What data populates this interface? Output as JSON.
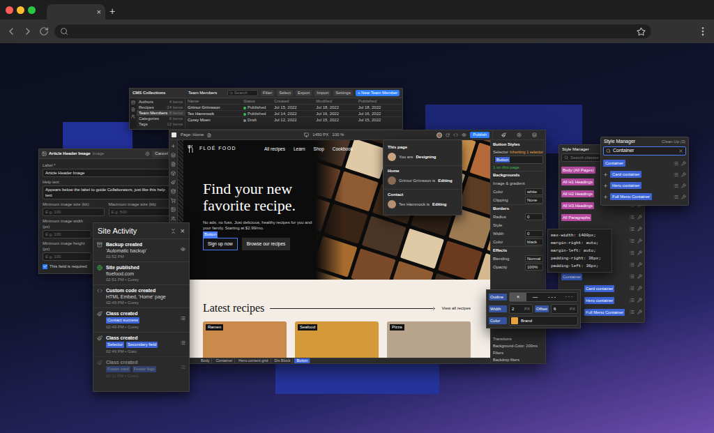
{
  "browser": {
    "tab_close": "×",
    "new_tab": "+"
  },
  "cms": {
    "title": "CMS Collections",
    "collection": "Team Members",
    "search": "Search",
    "actions": [
      "Filter",
      "Select",
      "Export",
      "Import",
      "Settings"
    ],
    "new_item": "+ New Team Member",
    "collections": [
      {
        "name": "Authors",
        "count": "4 items",
        "selected": false
      },
      {
        "name": "Recipes",
        "count": "24 items",
        "selected": false
      },
      {
        "name": "Team Members",
        "count": "8 items",
        "selected": true
      },
      {
        "name": "Categories",
        "count": "6 items",
        "selected": false
      },
      {
        "name": "Tags",
        "count": "12 items",
        "selected": false
      }
    ],
    "columns": [
      "Name",
      "Status",
      "Created",
      "Modified",
      "Published"
    ],
    "rows": [
      {
        "name": "Grímur Grímsson",
        "status": "Published",
        "color": "#3fb950",
        "created": "Jul 15, 2022",
        "modified": "Jul 18, 2022",
        "published": "Jul 18, 2022"
      },
      {
        "name": "Tex Hammock",
        "status": "Published",
        "color": "#3fb950",
        "created": "Jul 14, 2022",
        "modified": "Jul 16, 2022",
        "published": "Jul 16, 2022"
      },
      {
        "name": "Corey Moen",
        "status": "Draft",
        "color": "#8a8a8a",
        "created": "Jul 12, 2022",
        "modified": "Jul 15, 2022",
        "published": "Jul 15, 2022"
      }
    ]
  },
  "field_settings": {
    "title": "Article Header Image",
    "type": "Image",
    "cancel": "Cancel",
    "label_caption": "Label *",
    "label_value": "Article Header Image",
    "help_caption": "Help text",
    "help_value": "Appears below the label to guide Collaborators, just like this help text",
    "size_fields": [
      {
        "label": "Minimum image size (kb)",
        "placeholder": "E.g. 100"
      },
      {
        "label": "Maximum image size (kb)",
        "placeholder": "E.g. 500"
      }
    ],
    "dimension_fields": [
      {
        "label": "Minimum image width (px)",
        "placeholder": "E.g. 100"
      },
      {
        "label": "Minimum image height (px)",
        "placeholder": "E.g. 100"
      }
    ],
    "required": {
      "label": "This field is required",
      "checked": true
    }
  },
  "site_activity": {
    "title": "Site Activity",
    "close": "×",
    "items": [
      {
        "kind": "backup",
        "title": "Backup created",
        "detail": "'Automatic backup'",
        "tags": [],
        "meta": "02:52 PM",
        "faded": false
      },
      {
        "kind": "publish",
        "title": "Site published",
        "detail": "floefood.com",
        "tags": [],
        "meta": "02:51 PM • Corey",
        "faded": false
      },
      {
        "kind": "code",
        "title": "Custom code created",
        "detail": "HTML Embed, 'Home' page",
        "tags": [],
        "meta": "02:49 PM • Corey",
        "faded": false
      },
      {
        "kind": "class",
        "title": "Class created",
        "tags": [
          "Contact success"
        ],
        "meta": "02:49 PM • Corey",
        "faded": false
      },
      {
        "kind": "class",
        "title": "Class created",
        "tags": [
          "Selector",
          "Secondary field"
        ],
        "meta": "02:49 PM • Gato",
        "faded": false
      },
      {
        "kind": "class",
        "title": "Class created",
        "tags": [
          "Footer card",
          "Footer logo"
        ],
        "meta": "02:11 PM • Corey",
        "faded": true
      }
    ]
  },
  "designer": {
    "page": "Page: Home",
    "canvas_size": "1450 PX",
    "zoom": "100 %",
    "publish": "Publish",
    "site": {
      "brand": "FLOÉ FOOD",
      "nav": [
        "All recipes",
        "Learn",
        "Shop",
        "Cookbook"
      ],
      "heading": "Find your new favorite recipe.",
      "subtext": "No ads, no fuss. Just delicious, healthy recipes for you and your family. Starting at $2.99/mo.",
      "primary_button": "Sign up now",
      "selected_badge": "Button",
      "secondary_button": "Browse our recipes",
      "section_title": "Latest recipes",
      "view_all": "View all recipes",
      "cards": [
        "Ramen",
        "Seafood",
        "Pizza"
      ]
    },
    "breadcrumb": [
      {
        "label": "Body",
        "selected": false
      },
      {
        "label": "Container",
        "selected": false
      },
      {
        "label": "Hero content grid",
        "selected": false
      },
      {
        "label": "Div Block",
        "selected": false
      },
      {
        "label": "Button",
        "selected": true
      }
    ]
  },
  "presence": {
    "sections": [
      {
        "heading": "This page",
        "person": "You are",
        "activity": "Designing"
      },
      {
        "heading": "Home",
        "person": "Grímur Grímsson is",
        "activity": "Editing"
      },
      {
        "heading": "Contact",
        "person": "Tex Hammock is",
        "activity": "Editing"
      }
    ]
  },
  "style_panel": {
    "title": "Button Styles",
    "selector_label": "Selector",
    "inheriting": "Inheriting 1 selector",
    "selector_chip": "Button",
    "usage": "1 on this page",
    "sections": [
      {
        "heading": "Backgrounds",
        "rows": [
          {
            "label": "Image & gradient"
          },
          {
            "label": "Color",
            "value": "white"
          },
          {
            "label": "Clipping",
            "value": "None"
          }
        ]
      },
      {
        "heading": "Borders",
        "rows": [
          {
            "label": "Radius",
            "value": "0"
          },
          {
            "label": "Style"
          },
          {
            "label": "Width",
            "value": "0"
          },
          {
            "label": "Color",
            "value": "black"
          }
        ]
      },
      {
        "heading": "Effects",
        "rows": [
          {
            "label": "Blending",
            "value": "Normal"
          },
          {
            "label": "Opacity",
            "value": "100%"
          }
        ]
      }
    ],
    "lower_rows": [
      "Transitions",
      "Background-Color: 200ms",
      "Filters",
      "Backdrop filters"
    ]
  },
  "style_manager": {
    "title": "Style Manager",
    "search": "Search classes",
    "global": [
      "Body (All Pages)",
      "All H1 Headings",
      "All H2 Headings",
      "All H3 Headings",
      "All Paragraphs"
    ],
    "classes": [
      {
        "name": "Container",
        "nested": false
      },
      {
        "name": "Card container",
        "nested": true
      },
      {
        "name": "Hero container",
        "nested": true
      },
      {
        "name": "Full Menu Container",
        "nested": true
      }
    ]
  },
  "style_manager_search": {
    "title": "Style Manager",
    "cleanup": "Clean Up (3)",
    "query": "Container",
    "results": [
      {
        "name": "Container",
        "nested": false
      },
      {
        "name": "Card container",
        "nested": true
      },
      {
        "name": "Hero container",
        "nested": true
      },
      {
        "name": "Full Menu Container",
        "nested": true
      }
    ]
  },
  "css_preview": {
    "lines": [
      "max-width: 1400px;",
      "margin-right: auto;",
      "margin-left: auto;",
      "padding-right: 36px;",
      "padding-left: 36px;"
    ]
  },
  "outline": {
    "label": "Outline",
    "styles": [
      {
        "glyph": "×",
        "selected": true
      },
      {
        "glyph": "—",
        "selected": false
      },
      {
        "glyph": "- - -",
        "selected": false
      },
      {
        "glyph": "· · ·",
        "selected": false
      }
    ],
    "width_label": "Width",
    "width": "2",
    "width_unit": "PX",
    "offset_label": "Offset",
    "offset": "6",
    "offset_unit": "PX",
    "color_label": "Color",
    "color_name": "Brand",
    "color": "#e8a33d"
  }
}
